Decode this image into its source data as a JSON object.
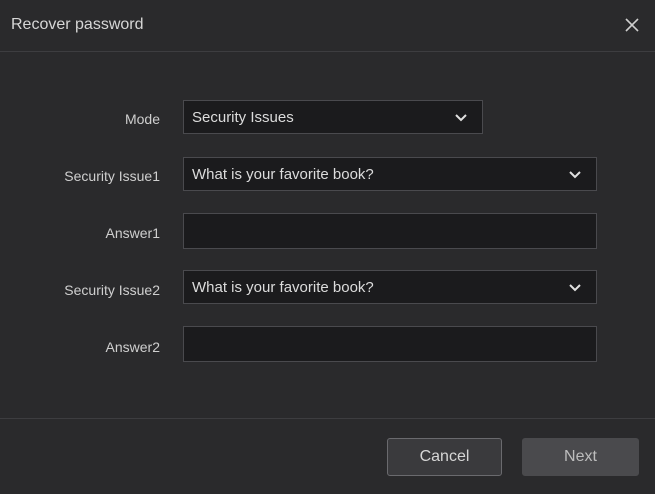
{
  "dialog": {
    "title": "Recover password"
  },
  "form": {
    "mode": {
      "label": "Mode",
      "value": "Security Issues"
    },
    "security_issue1": {
      "label": "Security Issue1",
      "value": "What is your favorite book?"
    },
    "answer1": {
      "label": "Answer1",
      "value": ""
    },
    "security_issue2": {
      "label": "Security Issue2",
      "value": "What is your favorite book?"
    },
    "answer2": {
      "label": "Answer2",
      "value": ""
    }
  },
  "footer": {
    "cancel_label": "Cancel",
    "next_label": "Next"
  },
  "icons": {
    "close": "close-icon",
    "dropdown": "chevron-down-icon"
  },
  "colors": {
    "background": "#2a2a2c",
    "field": "#1b1b1d",
    "field_border": "#4a4a4e",
    "text": "#d6d6d6"
  }
}
